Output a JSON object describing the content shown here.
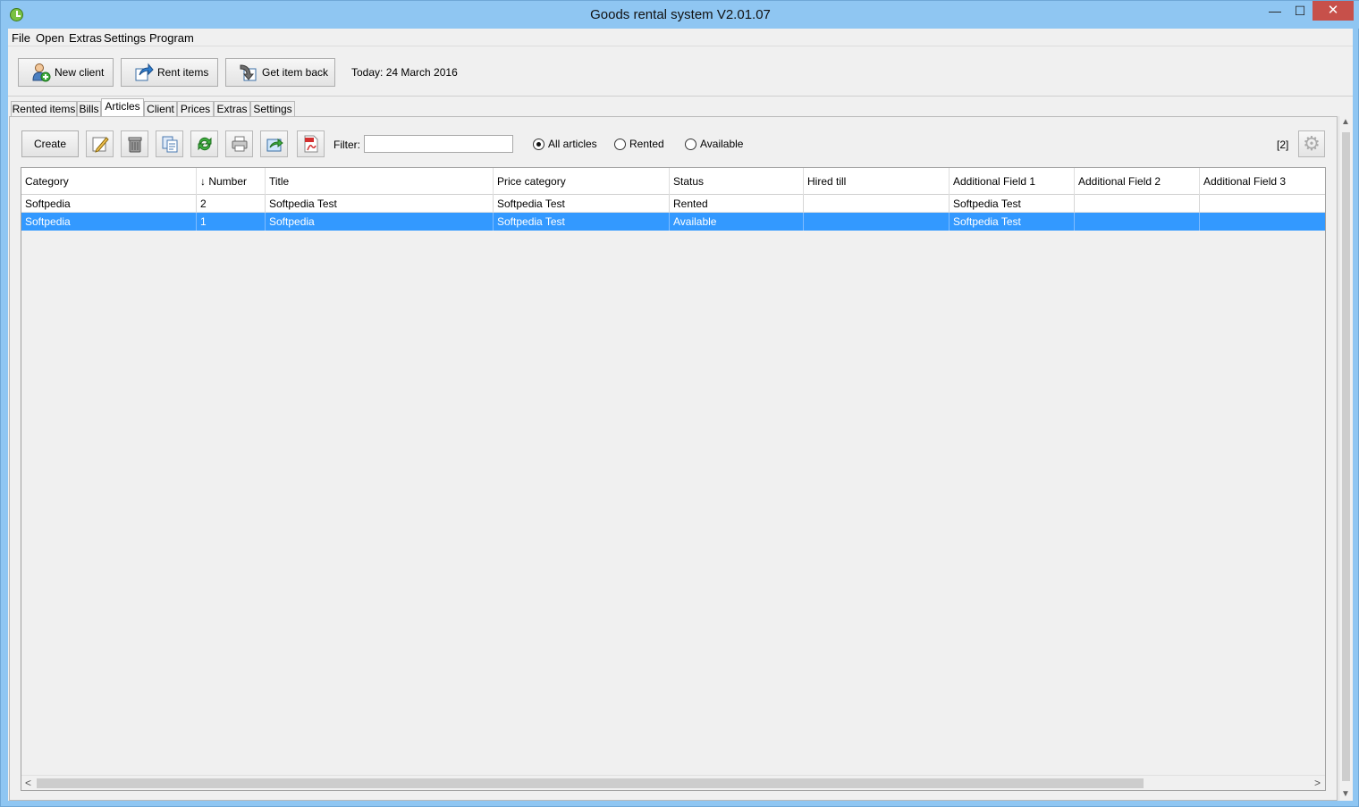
{
  "window": {
    "title": "Goods rental system V2.01.07",
    "min_glyph": "—",
    "max_glyph": "☐",
    "close_glyph": "✕"
  },
  "menu": [
    "File",
    "Open",
    "Extras",
    "Settings",
    "Program"
  ],
  "toolbar": {
    "new_client": "New client",
    "rent_items": "Rent items",
    "get_item_back": "Get item back",
    "today": "Today: 24 March 2016"
  },
  "tabs": [
    "Rented items",
    "Bills",
    "Articles",
    "Client",
    "Prices",
    "Extras",
    "Settings"
  ],
  "active_tab": "Articles",
  "articles": {
    "create_label": "Create",
    "tool_icons": [
      "edit-icon",
      "trash-icon",
      "copy-icon",
      "refresh-icon",
      "print-icon",
      "export-icon",
      "pdf-icon"
    ],
    "filter_label": "Filter:",
    "filter_value": "",
    "radios": [
      {
        "label": "All articles",
        "checked": true
      },
      {
        "label": "Rented",
        "checked": false
      },
      {
        "label": "Available",
        "checked": false
      }
    ],
    "count": "[2]",
    "gear_glyph": "⚙"
  },
  "table": {
    "columns": [
      "Category",
      "↓ Number",
      "Title",
      "Price category",
      "Status",
      "Hired till",
      "Additional Field 1",
      "Additional Field 2",
      "Additional Field 3"
    ],
    "rows": [
      [
        "Softpedia",
        "2",
        "Softpedia Test",
        "Softpedia Test",
        "Rented",
        "",
        "Softpedia Test",
        "",
        ""
      ],
      [
        "Softpedia",
        "1",
        "Softpedia",
        "Softpedia Test",
        "Available",
        "",
        "Softpedia Test",
        "",
        ""
      ]
    ],
    "selected_row": 1
  },
  "scroll_glyphs": {
    "left": "<",
    "right": ">",
    "up": "▲",
    "down": "▼"
  }
}
